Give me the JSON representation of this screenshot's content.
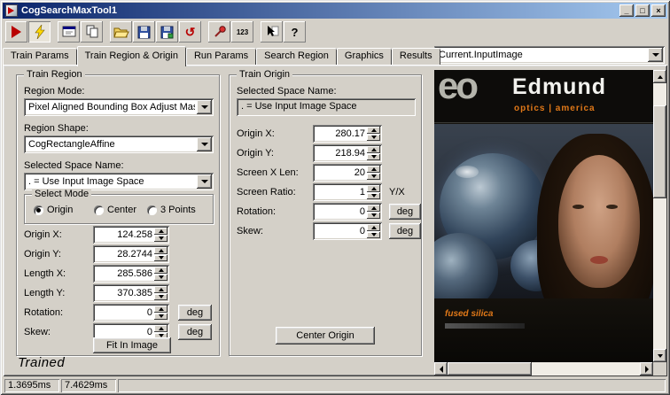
{
  "window": {
    "title": "CogSearchMaxTool1",
    "controls": {
      "minimize": "_",
      "maximize": "□",
      "close": "×"
    }
  },
  "toolbar": {
    "reset_glyph": "↺",
    "precision_label": "123",
    "help_label": "?"
  },
  "tabs": [
    "Train Params",
    "Train Region & Origin",
    "Run Params",
    "Search Region",
    "Graphics",
    "Results"
  ],
  "image_selector": {
    "value": "Current.InputImage"
  },
  "train_region": {
    "title": "Train Region",
    "region_mode_label": "Region Mode:",
    "region_mode_value": "Pixel Aligned Bounding Box Adjust Mask",
    "region_shape_label": "Region Shape:",
    "region_shape_value": "CogRectangleAffine",
    "space_label": "Selected Space Name:",
    "space_value": ". = Use Input Image Space",
    "select_mode": {
      "title": "Select Mode",
      "options": [
        "Origin",
        "Center",
        "3 Points"
      ],
      "selected": "Origin"
    },
    "fields": [
      {
        "label": "Origin X:",
        "value": "124.258"
      },
      {
        "label": "Origin Y:",
        "value": "28.2744"
      },
      {
        "label": "Length X:",
        "value": "285.586"
      },
      {
        "label": "Length Y:",
        "value": "370.385"
      },
      {
        "label": "Rotation:",
        "value": "0",
        "unit": "deg"
      },
      {
        "label": "Skew:",
        "value": "0",
        "unit": "deg"
      }
    ],
    "fit_button": "Fit In Image"
  },
  "train_origin": {
    "title": "Train Origin",
    "space_label": "Selected Space Name:",
    "space_value": ". = Use Input Image Space",
    "fields": [
      {
        "label": "Origin X:",
        "value": "280.17"
      },
      {
        "label": "Origin Y:",
        "value": "218.94"
      },
      {
        "label": "Screen X Len:",
        "value": "20"
      },
      {
        "label": "Screen Ratio:",
        "value": "1",
        "unit": "Y/X"
      },
      {
        "label": "Rotation:",
        "value": "0",
        "unit": "deg"
      },
      {
        "label": "Skew:",
        "value": "0",
        "unit": "deg"
      }
    ],
    "center_button": "Center Origin"
  },
  "state": {
    "trained": "Trained"
  },
  "status": {
    "time1": "1.3695ms",
    "time2": "7.4629ms"
  },
  "image_panel": {
    "logo": "eo",
    "brand": "Edmund",
    "tagline": "optics | america",
    "caption": "fused silica"
  }
}
